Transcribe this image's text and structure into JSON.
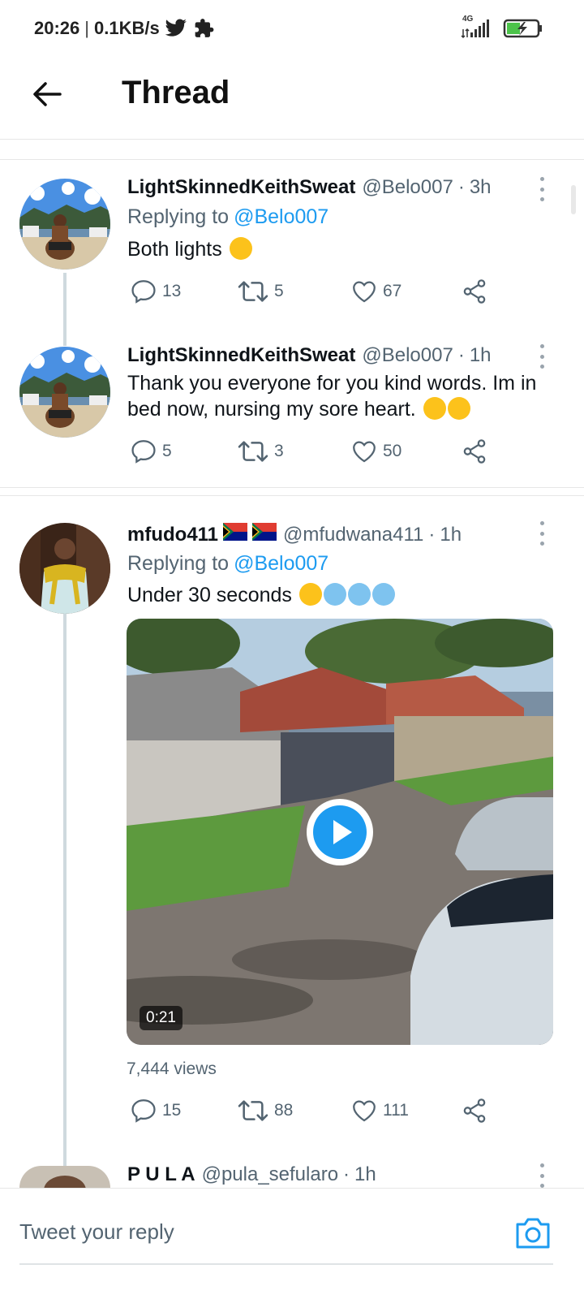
{
  "status_bar": {
    "time": "20:26",
    "speed": "0.1KB/s",
    "network": "4G"
  },
  "header": {
    "title": "Thread"
  },
  "tweets": [
    {
      "name": "LightSkinnedKeithSweat",
      "handle": "@Belo007",
      "time": "3h",
      "replying_label": "Replying to",
      "replying_to": "@Belo007",
      "text": "Both lights",
      "replies": "13",
      "retweets": "5",
      "likes": "67"
    },
    {
      "name": "LightSkinnedKeithSweat",
      "handle": "@Belo007",
      "time": "1h",
      "text": "Thank you everyone for you kind words. Im in bed now, nursing my sore heart.",
      "replies": "5",
      "retweets": "3",
      "likes": "50"
    },
    {
      "name": "mfudo411",
      "handle": "@mfudwana411",
      "time": "1h",
      "replying_label": "Replying to",
      "replying_to": "@Belo007",
      "text": "Under 30 seconds",
      "video_duration": "0:21",
      "views": "7,444 views",
      "replies": "15",
      "retweets": "88",
      "likes": "111"
    },
    {
      "name": "P U L A",
      "handle": "@pula_sefularo",
      "time": "1h"
    }
  ],
  "reply_bar": {
    "placeholder": "Tweet your reply"
  },
  "separator": "·",
  "colors": {
    "accent": "#1d9bf0",
    "muted": "#536471",
    "thread_line": "#cfd9de"
  }
}
